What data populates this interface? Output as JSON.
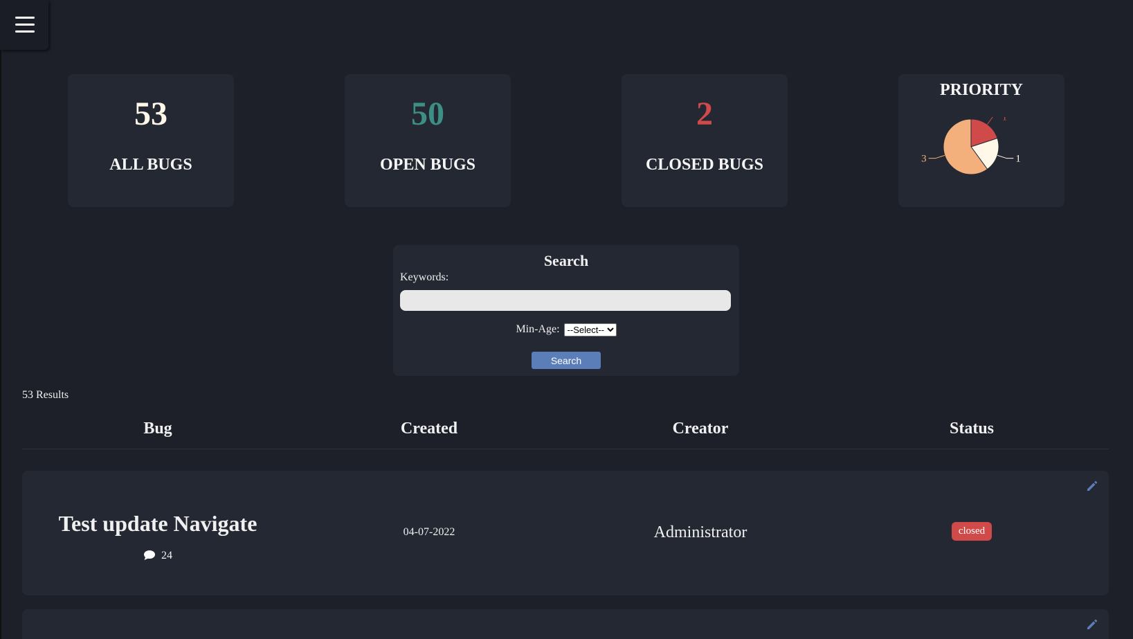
{
  "header": {
    "menu_icon": "hamburger-menu-icon"
  },
  "stats": [
    {
      "value": "53",
      "label": "ALL BUGS",
      "color": "#fff8e8"
    },
    {
      "value": "50",
      "label": "OPEN BUGS",
      "color": "#3d8f86"
    },
    {
      "value": "2",
      "label": "CLOSED BUGS",
      "color": "#d14a4a"
    }
  ],
  "priority": {
    "title": "PRIORITY",
    "chart_data": {
      "type": "pie",
      "title": "PRIORITY",
      "slices": [
        {
          "label": "3",
          "value": 3,
          "color": "#f4b07c"
        },
        {
          "label": "1",
          "value": 1,
          "color": "#d14a4a"
        },
        {
          "label": "1",
          "value": 1,
          "color": "#fff8e8"
        }
      ]
    }
  },
  "search": {
    "title": "Search",
    "keywords_label": "Keywords:",
    "keywords_value": "",
    "min_age_label": "Min-Age:",
    "min_age_selected": "--Select--",
    "button_label": "Search"
  },
  "results": {
    "count_text": "53 Results",
    "columns": [
      "Bug",
      "Created",
      "Creator",
      "Status"
    ],
    "rows": [
      {
        "title": "Test update Navigate",
        "comments": "24",
        "created": "04-07-2022",
        "creator": "Administrator",
        "status": "closed",
        "status_color": "#d14a4a"
      }
    ]
  },
  "colors": {
    "background": "#1d2029",
    "card": "#242832",
    "accent": "#5b7db8"
  }
}
